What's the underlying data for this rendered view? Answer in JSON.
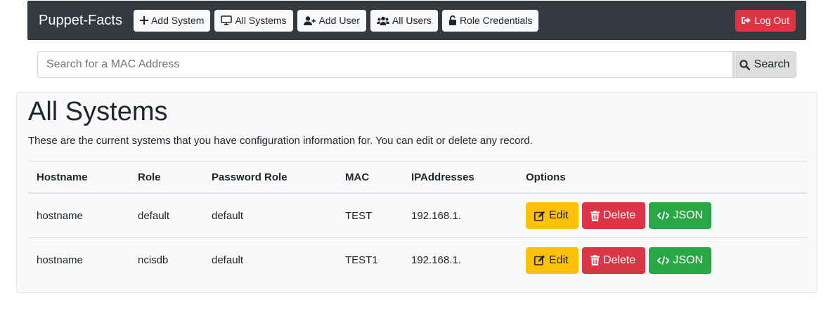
{
  "navbar": {
    "brand": "Puppet-Facts",
    "buttons": [
      {
        "label": "Add System",
        "icon": "plus-icon"
      },
      {
        "label": "All Systems",
        "icon": "desktop-icon"
      },
      {
        "label": "Add User",
        "icon": "user-plus-icon"
      },
      {
        "label": "All Users",
        "icon": "users-icon"
      },
      {
        "label": "Role Credentials",
        "icon": "unlock-icon"
      }
    ],
    "logout": {
      "label": "Log Out",
      "icon": "sign-out-icon"
    }
  },
  "search": {
    "placeholder": "Search for a MAC Address",
    "value": "",
    "button_label": "Search",
    "icon": "search-icon"
  },
  "main": {
    "title": "All Systems",
    "lead": "These are the current systems that you have configuration information for. You can edit or delete any record.",
    "table": {
      "headers": [
        "Hostname",
        "Role",
        "Password Role",
        "MAC",
        "IPAddresses",
        "Options"
      ],
      "rows": [
        {
          "hostname": "hostname",
          "role": "default",
          "password_role": "default",
          "mac": "TEST",
          "ip": "192.168.1."
        },
        {
          "hostname": "hostname",
          "role": "ncisdb",
          "password_role": "default",
          "mac": "TEST1",
          "ip": "192.168.1."
        }
      ],
      "actions": {
        "edit": "Edit",
        "delete": "Delete",
        "json": "JSON"
      }
    }
  },
  "colors": {
    "navbar_bg": "#343a40",
    "danger": "#dc3545",
    "warning": "#ffc107",
    "success": "#28a745",
    "card_bg": "#f8f9fa"
  }
}
